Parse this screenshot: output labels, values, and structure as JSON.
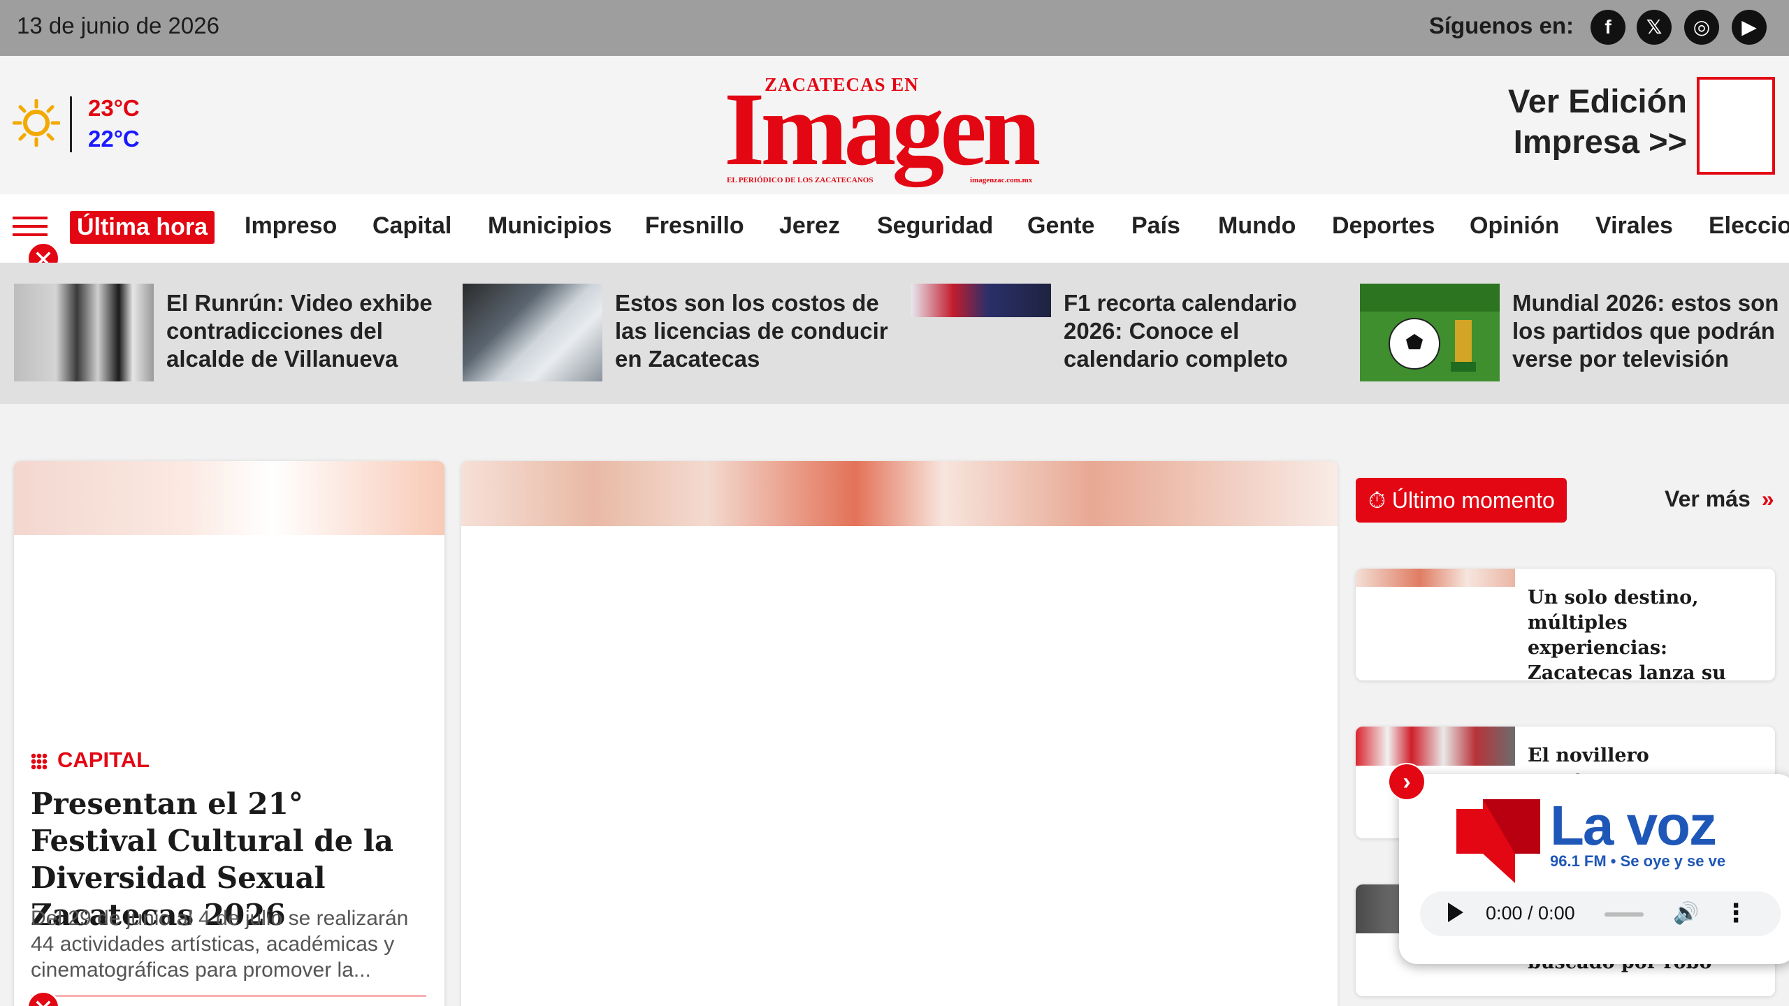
{
  "topbar": {
    "date": "13 de junio de 2026",
    "follow_label": "Síguenos en:",
    "social": [
      {
        "name": "facebook-icon",
        "glyph": "f"
      },
      {
        "name": "x-twitter-icon",
        "glyph": "𝕏"
      },
      {
        "name": "instagram-icon",
        "glyph": "◎"
      },
      {
        "name": "youtube-icon",
        "glyph": "▶"
      }
    ]
  },
  "weather": {
    "icon": "sun-icon",
    "high": "23°C",
    "low": "22°C"
  },
  "logo": {
    "small": "ZACATECAS EN",
    "big": "Imagen",
    "tagline": "EL PERIÓDICO DE LOS ZACATECANOS",
    "url": "imagenzac.com.mx"
  },
  "print_edition": {
    "line1": "Ver Edición",
    "line2": "Impresa >>"
  },
  "nav": {
    "items": [
      "Última hora",
      "Impreso",
      "Capital",
      "Municipios",
      "Fresnillo",
      "Jerez",
      "Seguridad",
      "Gente",
      "País",
      "Mundo",
      "Deportes",
      "Opinión",
      "Virales",
      "Eleccio"
    ]
  },
  "trending": [
    {
      "title": "El Runrún: Video exhibe contradicciones del alcalde de Villanueva"
    },
    {
      "title": "Estos son los costos de las licencias de conducir en Zacatecas"
    },
    {
      "title": "F1 recorta calendario 2026: Conoce el calendario completo"
    },
    {
      "title": "Mundial 2026: estos son los partidos que podrán verse por televisión"
    }
  ],
  "main_story": {
    "section": "CAPITAL",
    "headline": "Presentan el 21° Festival Cultural de la Diversidad Sexual Zacatecas 2026",
    "excerpt": "Del 29 de junio al 4 de julio se realizarán 44 actividades artísticas, académicas y cinematográficas para promover la..."
  },
  "sidebar": {
    "last_moment": "⏱ Último momento",
    "see_more": "Ver más",
    "see_more_icon": "»",
    "items": [
      {
        "title": "Un solo destino, múltiples experiencias: Zacatecas lanza su gran"
      },
      {
        "title": "El novillero zacatecano"
      },
      {
        "title": "buscado por robo"
      }
    ]
  },
  "player": {
    "brand": "La voz",
    "frequency": "96.1 FM • Se oye y se ve",
    "time": "0:00 / 0:00",
    "arrow": "›",
    "more": "⋮",
    "volume": "🔊"
  },
  "close_glyph": "✕",
  "colors": {
    "accent": "#e30613",
    "radio_blue": "#1f57b8",
    "topbar": "#9e9e9e"
  }
}
